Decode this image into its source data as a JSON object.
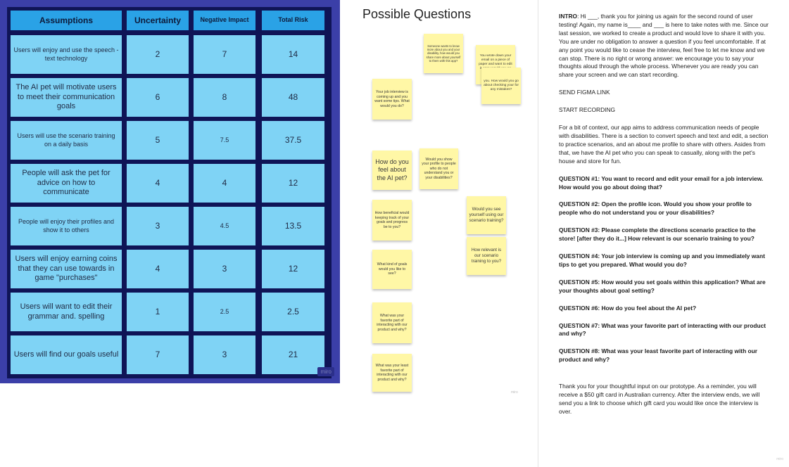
{
  "risk_table": {
    "headers": [
      "Assumptions",
      "Uncertainty",
      "Negative Impact",
      "Total Risk"
    ],
    "rows": [
      {
        "assumption": "Users will enjoy and use the speech - text technology",
        "uncertainty": "2",
        "impact": "7",
        "total": "14"
      },
      {
        "assumption": "The AI pet will motivate users to meet their communication goals",
        "uncertainty": "6",
        "impact": "8",
        "total": "48"
      },
      {
        "assumption": "Users will use the scenario training on a daily basis",
        "uncertainty": "5",
        "impact": "7.5",
        "total": "37.5"
      },
      {
        "assumption": "People will ask the pet for advice on how to communicate",
        "uncertainty": "4",
        "impact": "4",
        "total": "12"
      },
      {
        "assumption": "People will enjoy their profiles and show it to others",
        "uncertainty": "3",
        "impact": "4.5",
        "total": "13.5"
      },
      {
        "assumption": "Users will enjoy earning coins that they can use towards in game \"purchases\"",
        "uncertainty": "4",
        "impact": "3",
        "total": "12"
      },
      {
        "assumption": "Users will want to edit their grammar and. spelling",
        "uncertainty": "1",
        "impact": "2.5",
        "total": "2.5"
      },
      {
        "assumption": "Users will find our goals useful",
        "uncertainty": "7",
        "impact": "3",
        "total": "21"
      }
    ],
    "watermark": "miro"
  },
  "board": {
    "title": "Possible Questions",
    "stickies": [
      {
        "text": "Someone wants to know more about you and your disability, how would you share more about yourself to them with this app?"
      },
      {
        "text": "You wrote down your email on a piece of paper and want to edit it. How would you go about doing that?"
      },
      {
        "text": "you. How would you go about checking your for any mistakes?"
      },
      {
        "text": "Your job interview is coming up and you want some tips. What would you do?"
      },
      {
        "text": "How do you feel about the AI pet?"
      },
      {
        "text": "Would you show your profile to people who do not understand you or your disabilities?"
      },
      {
        "text": "How beneficial would keeping track of your goals and progress be to you?"
      },
      {
        "text": "Would you see yourself using our scenario training?"
      },
      {
        "text": "How relevant is our scenario training to you?"
      },
      {
        "text": "What kind of goals would you like to see?"
      },
      {
        "text": "What was your favorite part of interacting with our product and why?"
      },
      {
        "text": "What was your least favorite part of interacting with our product and why?"
      }
    ],
    "watermark": "miro"
  },
  "script": {
    "intro_label": "INTRO",
    "intro_text": ": Hi ___, thank you for joining us again for the second round of user testing! Again, my name is____ and ___ is here to take notes with me. Since our last session, we worked to create a product and would love to share it with you. You are under no obligation to answer a question if you feel uncomfortable. If at any point you would like to cease the interview, feel free to let me know and we can stop. There is no right or wrong answer: we encourage you to say your thoughts aloud through the whole process. Whenever you are ready you can share your screen and we can start recording.",
    "send_figma": "SEND FIGMA LINK",
    "start_recording": "START RECORDING",
    "context": "For a bit of context, our app aims to address communication needs of people with disabilities. There is a section to convert speech and text and edit, a section to practice scenarios, and an about me profile to share with others. Asides from that, we have the AI pet who you can speak to casually, along with the pet's house and store for fun.",
    "questions": [
      "QUESTION #1: You want to record and edit your email for a job interview. How would you go about doing that?",
      "QUESTION #2: Open the profile icon. Would you show your profile to people who do not understand you or your disabilities?",
      "QUESTION #3: Please complete the directions scenario practice to the store! [after they do it...] How relevant is our scenario training to you?",
      "QUESTION #4: Your job interview is coming up and you immediately want tips to get you prepared. What would you do?",
      "QUESTION #5: How would you set goals within this application? What are your thoughts about goal setting?",
      "QUESTION #6: How do you feel about the AI pet?",
      "QUESTION #7: What was your favorite part of interacting with our product and why?",
      "QUESTION #8: What was your least favorite part of interacting with our product and why?"
    ],
    "closing": "Thank you for your thoughtful input on our prototype. As a reminder, you will receive a $50 gift card in Australian currency. After the interview ends, we will send you a link to choose which gift card you would like once the interview is over.",
    "watermark": "miro"
  }
}
